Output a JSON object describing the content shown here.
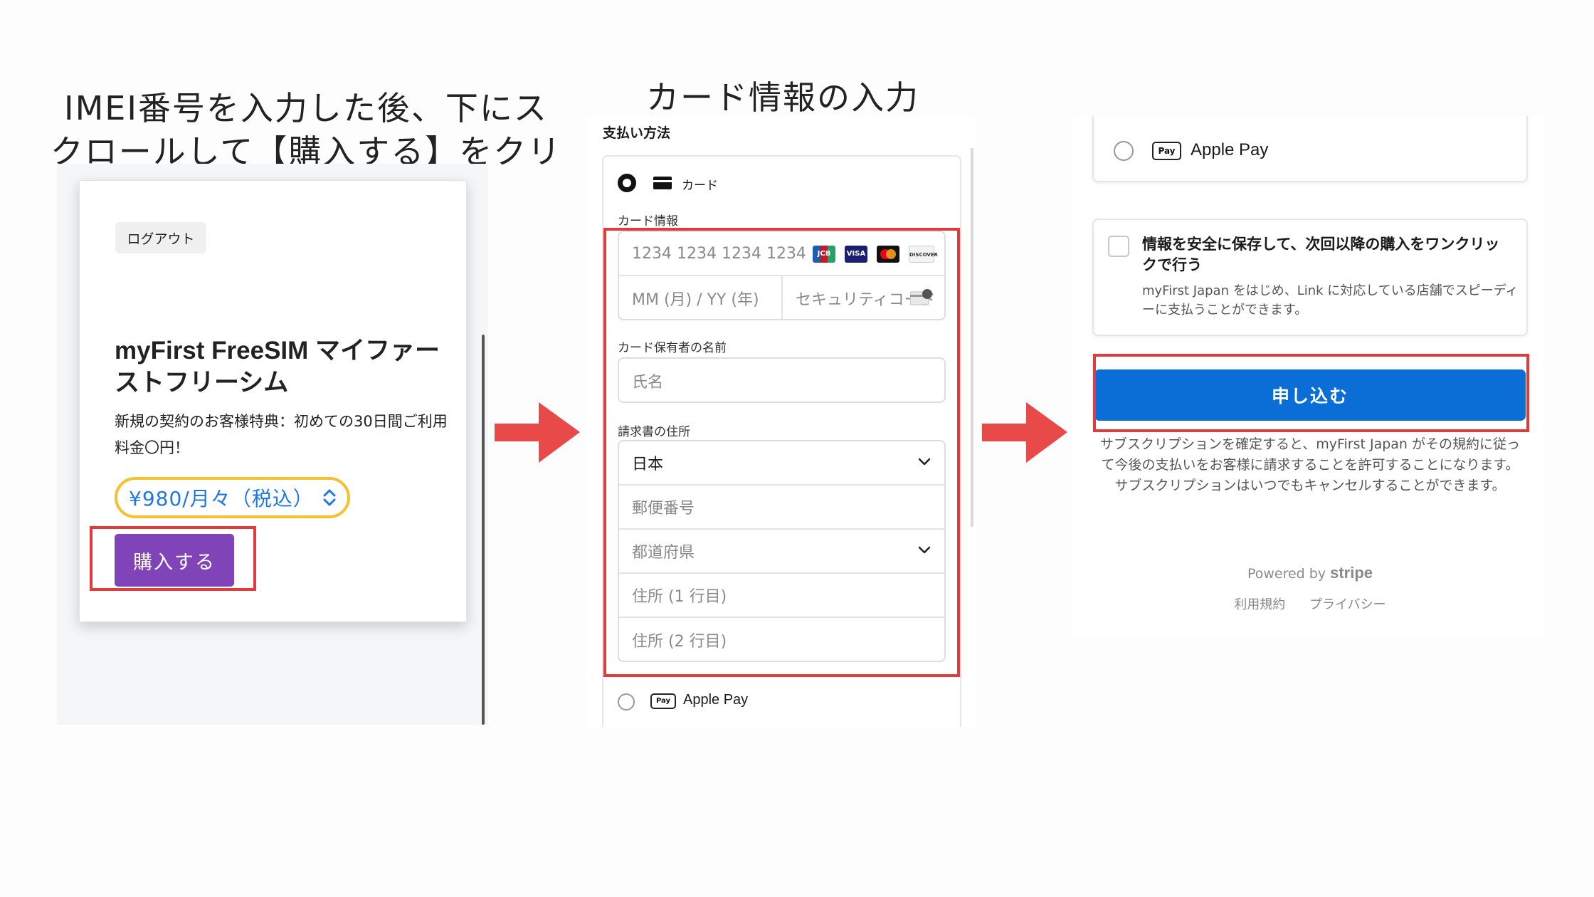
{
  "captions": {
    "step1": "IMEI番号を入力した後、下にスクロールして【購入する】をクリック",
    "step2": "カード情報の入力"
  },
  "panel1": {
    "logout_label": "ログアウト",
    "product_title": "myFirst FreeSIM マイファーストフリーシム",
    "description": "新規の契約のお客様特典：初めての30日間ご利用料金〇円！",
    "price_option": "¥980/月々（税込）",
    "buy_label": "購入する"
  },
  "panel2": {
    "payment_method_heading": "支払い方法",
    "card_option_label": "カード",
    "card_info_label": "カード情報",
    "card_number_placeholder": "1234 1234 1234 1234",
    "card_brands": [
      "JCB",
      "VISA",
      "Mastercard",
      "DISCOVER"
    ],
    "expiry_placeholder": "MM (月) / YY (年)",
    "cvc_placeholder": "セキュリティコード",
    "cardholder_label": "カード保有者の名前",
    "cardholder_placeholder": "氏名",
    "billing_label": "請求書の住所",
    "country_value": "日本",
    "postal_placeholder": "郵便番号",
    "prefecture_placeholder": "都道府県",
    "address1_placeholder": "住所 (1 行目)",
    "address2_placeholder": "住所 (2 行目)",
    "apple_pay_label": "Apple Pay",
    "apple_pay_badge": "Pay"
  },
  "panel3": {
    "apple_pay_label": "Apple Pay",
    "apple_pay_badge": "Pay",
    "save_title": "情報を安全に保存して、次回以降の購入をワンクリックで行う",
    "save_desc": "myFirst Japan をはじめ、Link に対応している店舗でスピーディーに支払うことができます。",
    "apply_label": "申し込む",
    "terms": "サブスクリプションを確定すると、myFirst Japan がその規約に従って今後の支払いをお客様に請求することを許可することになります。サブスクリプションはいつでもキャンセルすることができます。",
    "powered_by": "Powered by",
    "stripe": "stripe",
    "terms_link": "利用規約",
    "privacy_link": "プライバシー"
  },
  "colors": {
    "purchase_button": "#8043b8",
    "apply_button": "#0a6ed6",
    "highlight_box": "#e23b3b",
    "arrow": "#e84a4a",
    "price_border": "#f2c230",
    "price_text": "#1f78e0"
  }
}
